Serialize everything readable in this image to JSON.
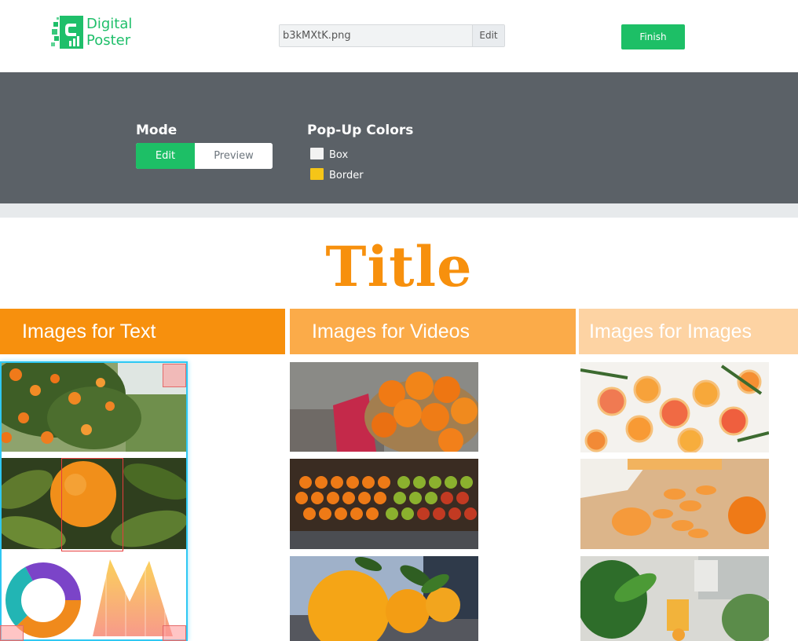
{
  "app": {
    "logo_line1": "Digital",
    "logo_line2": "Poster",
    "file_name": "b3kMXtK.png",
    "file_edit_label": "Edit",
    "finish_label": "Finish"
  },
  "controls": {
    "mode_label": "Mode",
    "mode_options": [
      "Edit",
      "Preview"
    ],
    "selected_mode": "Edit",
    "popup_colors_label": "Pop-Up Colors",
    "popup_colors": [
      {
        "label": "Box",
        "color": "#f2f2f2"
      },
      {
        "label": "Border",
        "color": "#f5c518"
      }
    ]
  },
  "poster": {
    "title": "Title",
    "columns": [
      {
        "heading": "Images for Text",
        "color": "#f7900d",
        "images": [
          "orange-tree-photo",
          "orange-on-branch-photo",
          "donut-and-area-chart"
        ]
      },
      {
        "heading": "Images for Videos",
        "color": "#fbab49",
        "images": [
          "oranges-in-basket-photo",
          "market-fruit-stand-photo",
          "oranges-with-leaves-photo"
        ]
      },
      {
        "heading": "Images for Images",
        "color": "#fdd3a3",
        "images": [
          "citrus-slices-photo",
          "peeled-tangerine-photo",
          "kitchen-juice-photo"
        ]
      }
    ]
  },
  "colors": {
    "accent_green": "#1dbf66",
    "panel_gray": "#5b6167",
    "title_orange": "#f7900d"
  }
}
